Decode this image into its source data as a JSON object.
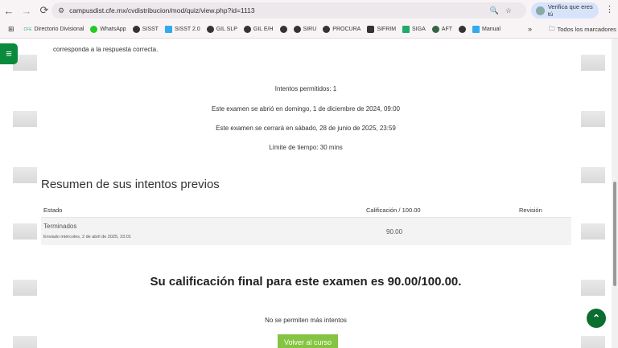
{
  "browser": {
    "url": "campusdist.cfe.mx/cvdistribucion/mod/quiz/view.php?id=1113",
    "verify": "Verifica que eres tú",
    "bookmarks": [
      "Directorio Divisional",
      "WhatsApp",
      "SISST",
      "SISST 2.0",
      "GIL SLP",
      "GIL E/H",
      "",
      "SIRU",
      "PROCURA",
      "SIFRIM",
      "SIGA",
      "AFT",
      "",
      "Manual"
    ],
    "all_bookmarks": "Todos los marcadores"
  },
  "page": {
    "intro_tail": "corresponda a la respuesta correcta.",
    "attempts_allowed": "Intentos permitidos: 1",
    "opened": "Este examen se abrió en domingo, 1 de diciembre de 2024, 09:00",
    "closes": "Este examen se cerrará en sábado, 28 de junio de 2025, 23:59",
    "time_limit": "Límite de tiempo: 30 mins",
    "summary_title": "Resumen de sus intentos previos",
    "table": {
      "headers": [
        "Estado",
        "Calificación / 100.00",
        "Revisión"
      ],
      "rows": [
        {
          "state": "Terminados",
          "submitted": "Enviado miércoles, 2 de abril de 2025, 23:01",
          "grade": "90.00",
          "review": ""
        }
      ]
    },
    "final_grade": "Su calificación final para este examen es 90.00/100.00.",
    "no_more": "No se permiten más intentos",
    "back_button": "Volver al curso"
  }
}
